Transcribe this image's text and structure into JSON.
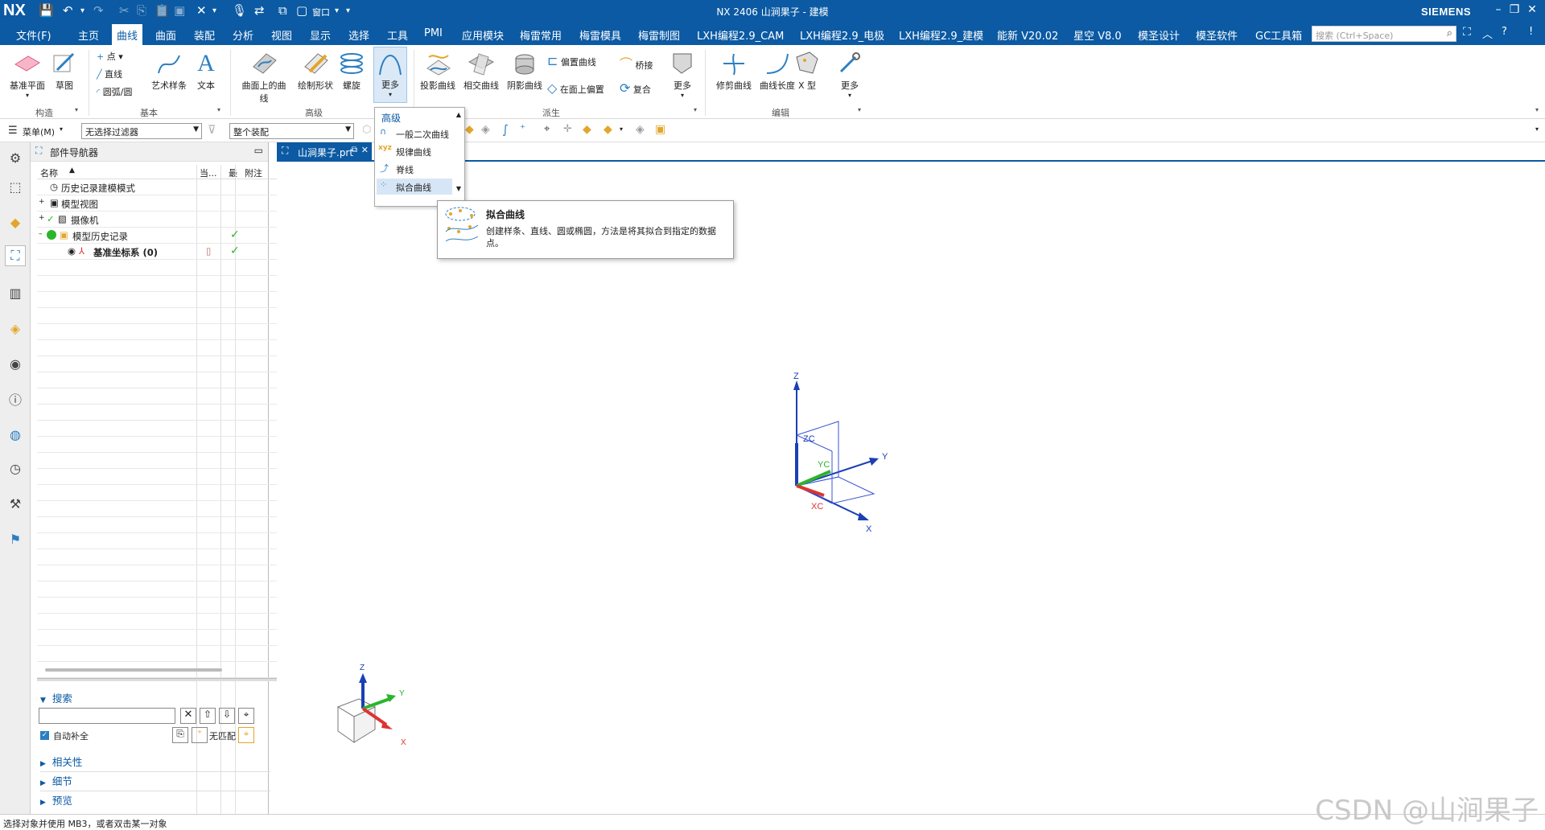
{
  "app": {
    "logo": "NX",
    "title": "NX 2406 山涧果子 - 建模",
    "brand": "SIEMENS",
    "window_menu": "窗口"
  },
  "menubar": {
    "items": [
      "文件(F)",
      "主页",
      "曲线",
      "曲面",
      "装配",
      "分析",
      "视图",
      "显示",
      "选择",
      "工具",
      "PMI",
      "应用模块",
      "梅雷常用",
      "梅雷模具",
      "梅雷制图",
      "LXH编程2.9_CAM",
      "LXH编程2.9_电极",
      "LXH编程2.9_建模",
      "能新 V20.02",
      "星空 V8.0",
      "模圣设计",
      "模圣软件",
      "GC工具箱"
    ],
    "active_index": 2,
    "search_placeholder": "搜索 (Ctrl+Space)"
  },
  "ribbon": {
    "groups": {
      "construct": "构造",
      "basic": "基本",
      "advanced": "高级",
      "derived": "派生",
      "edit": "编辑"
    },
    "buttons": {
      "datum_plane": "基准平面",
      "sketch": "草图",
      "point": "点",
      "line": "直线",
      "arc_circle": "圆弧/圆",
      "studio_spline": "艺术样条",
      "text": "文本",
      "curve_on_surface": "曲面上的曲线",
      "sketch_shape": "绘制形状",
      "helix": "螺旋",
      "more_advanced": "更多",
      "project_curve": "投影曲线",
      "intersection_curve": "相交曲线",
      "shadow_curve": "阴影曲线",
      "offset_curve": "偏置曲线",
      "offset_on_face": "在面上偏置",
      "bridge": "桥接",
      "composite": "复合",
      "more_derived": "更多",
      "trim_curve": "修剪曲线",
      "curve_length": "曲线长度",
      "x_form": "X 型",
      "more_edit": "更多"
    }
  },
  "toolbar2": {
    "menu_label": "菜单(M)",
    "filter": "无选择过滤器",
    "assembly": "整个装配"
  },
  "dropdown": {
    "title": "高级",
    "items": [
      "一般二次曲线",
      "规律曲线",
      "脊线",
      "拟合曲线"
    ],
    "highlight_index": 3
  },
  "tooltip": {
    "title": "拟合曲线",
    "body": "创建样条、直线、圆或椭圆，方法是将其拟合到指定的数据点。"
  },
  "navigator": {
    "title": "部件导航器",
    "columns": [
      "名称",
      "当...",
      "最",
      "附注"
    ],
    "rows": [
      {
        "label": "历史记录建模模式",
        "indent": 0
      },
      {
        "label": "模型视图",
        "indent": 0
      },
      {
        "label": "摄像机",
        "indent": 0
      },
      {
        "label": "模型历史记录",
        "indent": 0
      },
      {
        "label": "基准坐标系 (0)",
        "indent": 1
      }
    ],
    "search": {
      "title": "搜索",
      "autocomplete": "自动补全",
      "no_match": "无匹配"
    },
    "sections": [
      "相关性",
      "细节",
      "预览"
    ]
  },
  "doc_tab": "山涧果子.prt",
  "viewport": {
    "axes": {
      "z": "Z",
      "zc": "ZC",
      "yc": "YC",
      "y": "Y",
      "xc": "XC",
      "x": "X"
    },
    "triad": {
      "z": "Z",
      "y": "Y",
      "x": "X"
    }
  },
  "status": "选择对象并使用 MB3，或者双击某一对象",
  "watermark": "CSDN @山涧果子",
  "colors": {
    "brand_blue": "#0b5aa3",
    "check_green": "#2bb52b"
  }
}
